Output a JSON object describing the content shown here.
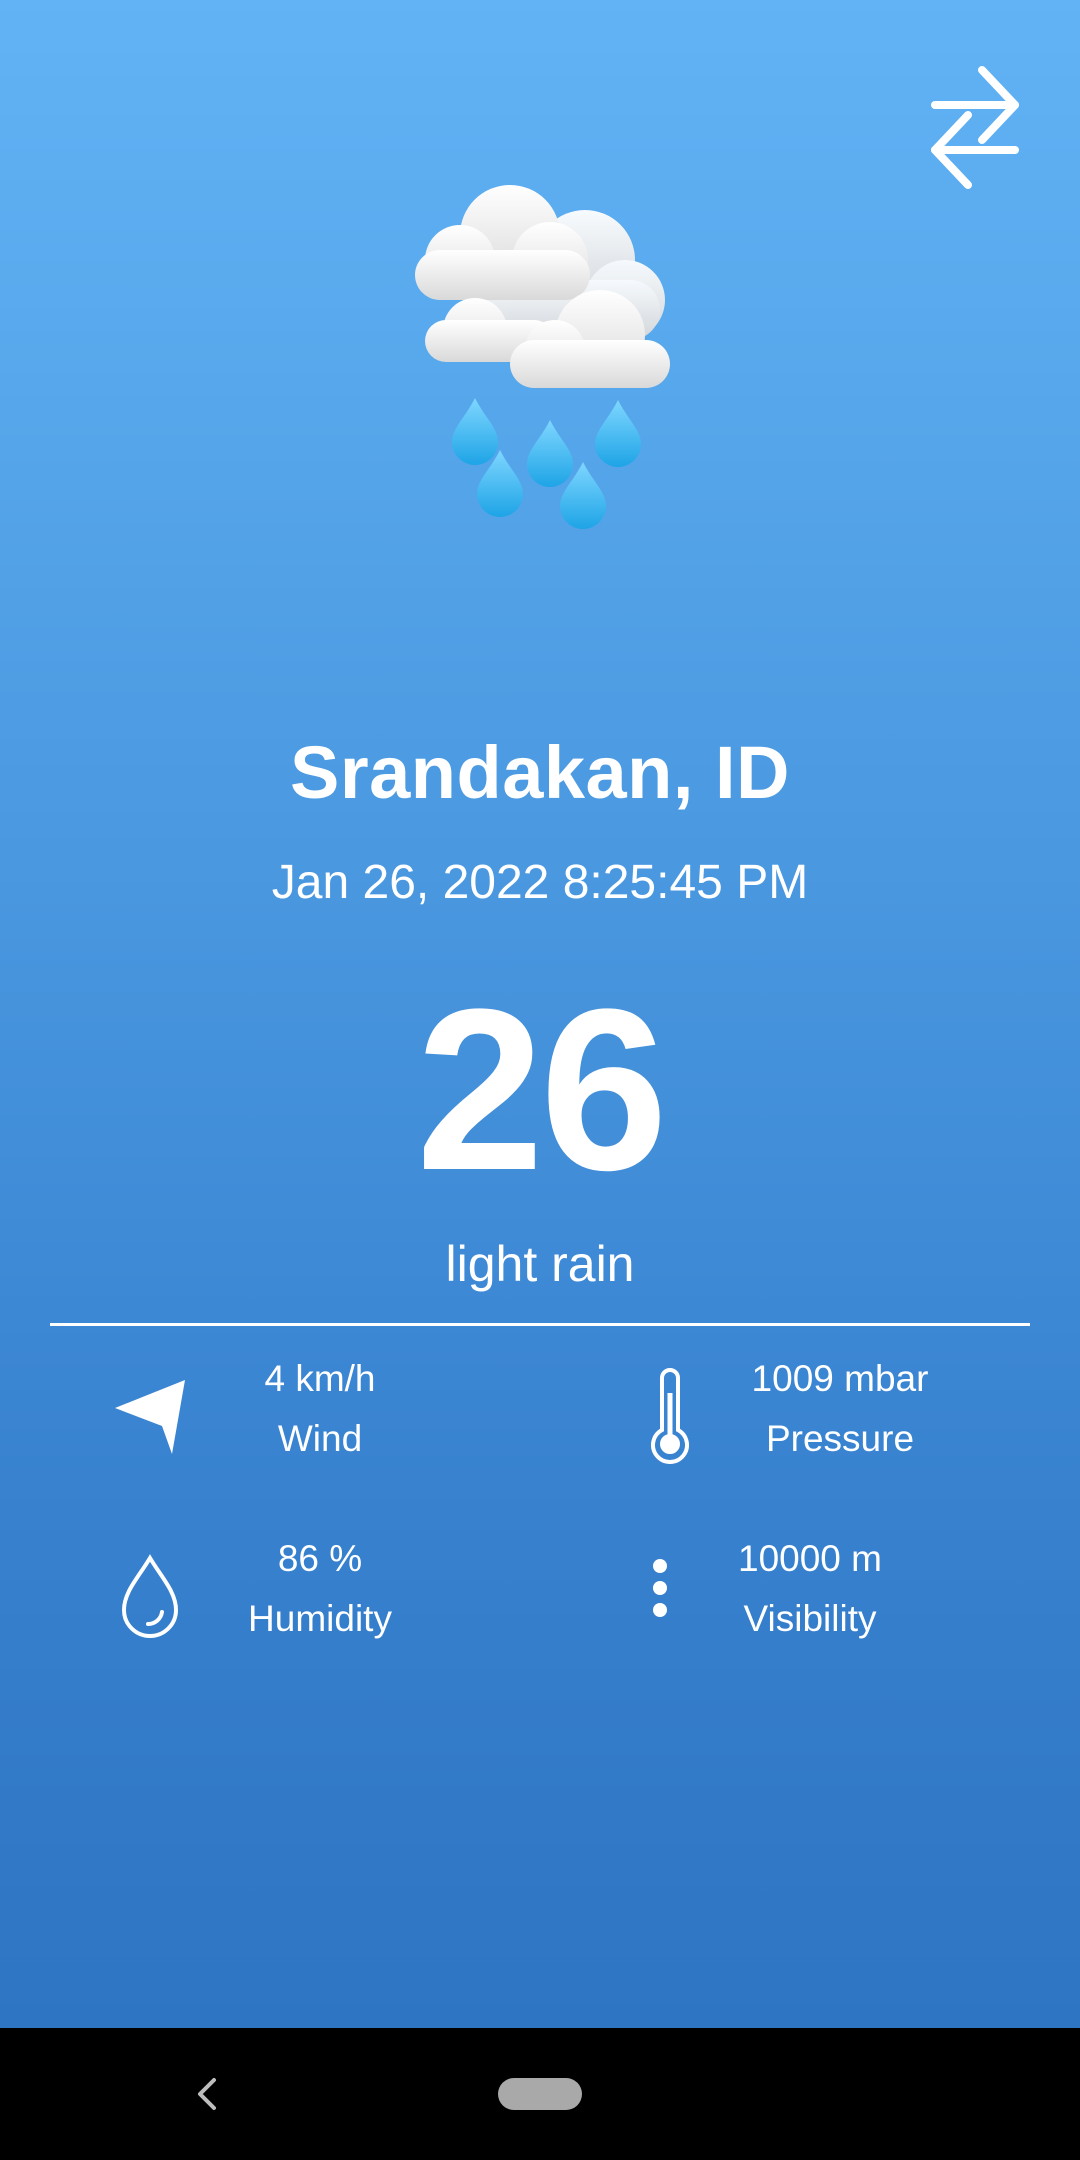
{
  "location": {
    "city": "Srandakan, ID"
  },
  "datetime": "Jan 26, 2022 8:25:45 PM",
  "current": {
    "temperature": "26",
    "condition": "light rain",
    "icon": "cloud-rain-icon"
  },
  "stats": {
    "wind": {
      "value": "4 km/h",
      "label": "Wind",
      "icon": "navigation-arrow-icon"
    },
    "pressure": {
      "value": "1009 mbar",
      "label": "Pressure",
      "icon": "thermometer-icon"
    },
    "humidity": {
      "value": "86 %",
      "label": "Humidity",
      "icon": "water-drop-icon"
    },
    "visibility": {
      "value": "10000 m",
      "label": "Visibility",
      "icon": "vertical-dots-icon"
    }
  },
  "actions": {
    "swap_icon": "swap-arrows-icon"
  },
  "navbar": {
    "back_icon": "back-chevron-icon",
    "home_icon": "home-pill-icon"
  },
  "colors": {
    "background_top": "#61b3f5",
    "background_bottom": "#2c72c0",
    "text": "#ffffff",
    "raindrop": "#3fb6ee"
  }
}
